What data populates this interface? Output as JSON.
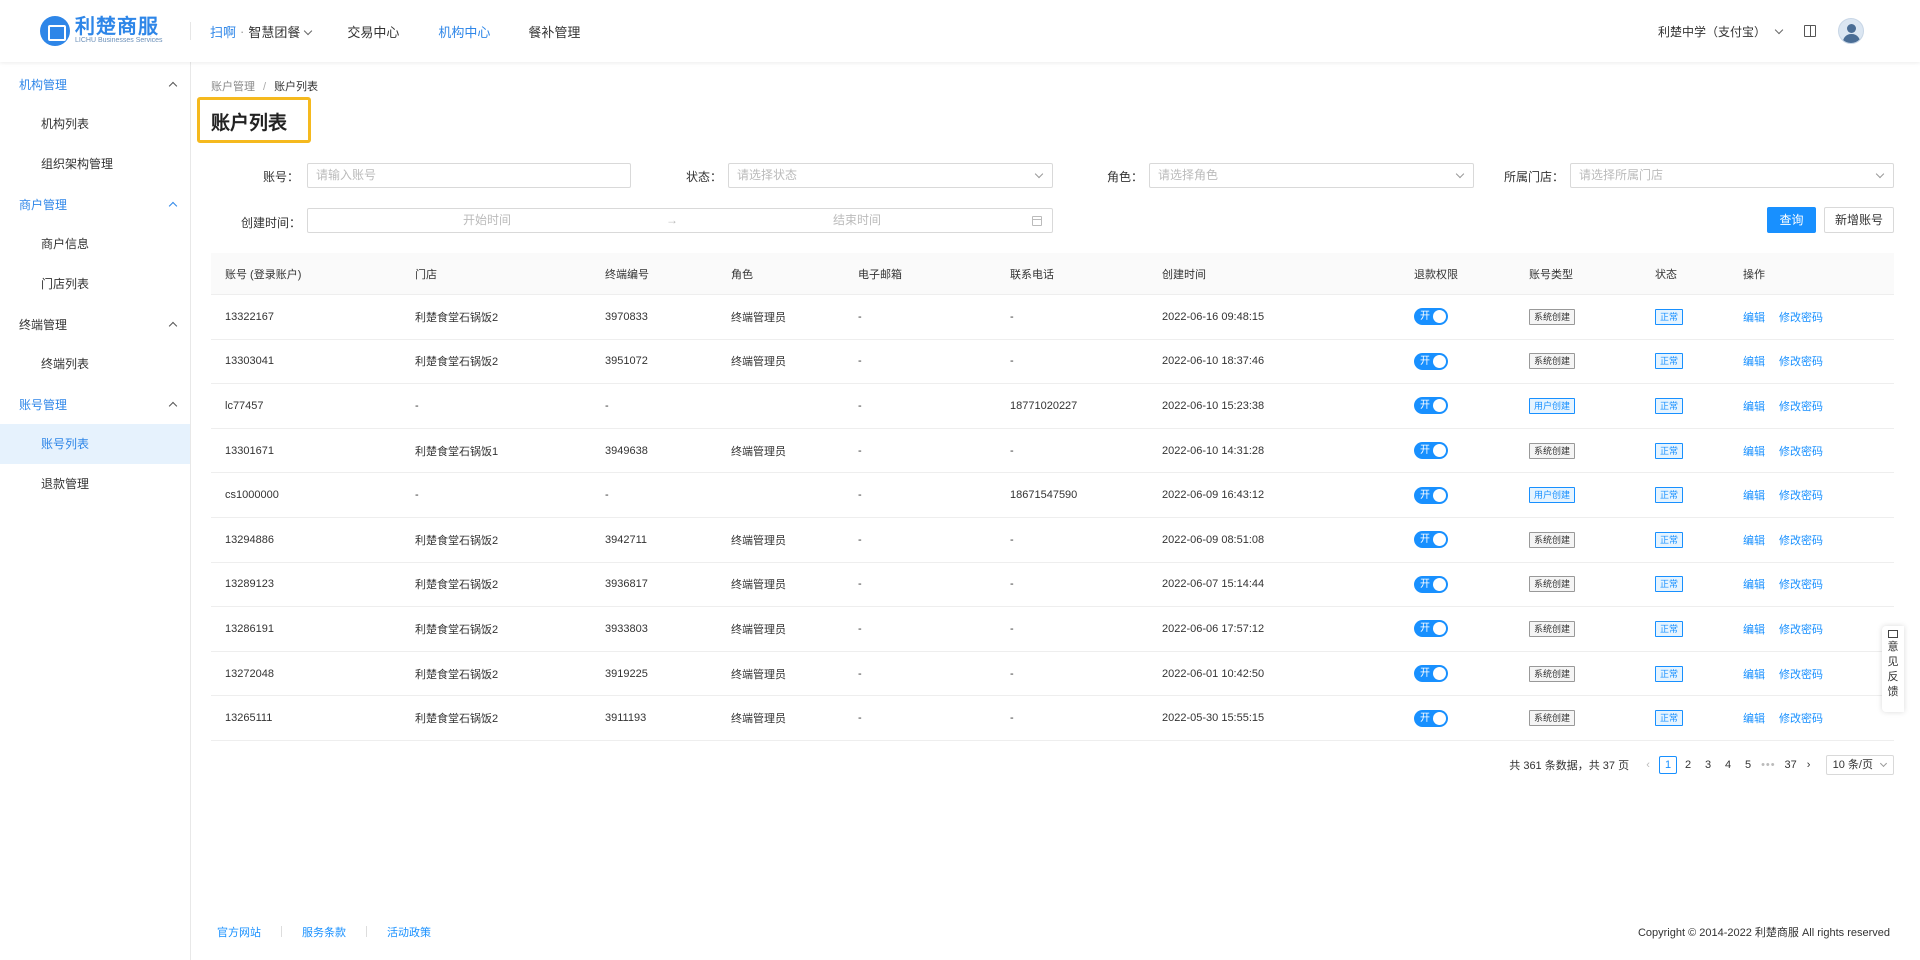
{
  "header": {
    "logo_cn": "利楚商服",
    "logo_en": "LICHU Businesses Services",
    "nav": {
      "scan": "扫啊",
      "dot": "·",
      "smart_meal": "智慧团餐",
      "trade_center": "交易中心",
      "org_center": "机构中心",
      "meal_subsidy": "餐补管理"
    },
    "account_name": "利楚中学（支付宝）"
  },
  "sidebar": {
    "groups": [
      {
        "label": "机构管理",
        "items": [
          "机构列表",
          "组织架构管理"
        ]
      },
      {
        "label": "商户管理",
        "items": [
          "商户信息",
          "门店列表"
        ]
      },
      {
        "label": "终端管理",
        "items": [
          "终端列表"
        ]
      },
      {
        "label": "账号管理",
        "items": [
          "账号列表",
          "退款管理"
        ]
      }
    ]
  },
  "breadcrumb": {
    "parent": "账户管理",
    "sep": "/",
    "current": "账户列表"
  },
  "page_title": "账户列表",
  "filters": {
    "account_label": "账号：",
    "account_placeholder": "请输入账号",
    "status_label": "状态：",
    "status_placeholder": "请选择状态",
    "role_label": "角色：",
    "role_placeholder": "请选择角色",
    "store_label": "所属门店：",
    "store_placeholder": "请选择所属门店",
    "created_label": "创建时间：",
    "start_placeholder": "开始时间",
    "date_sep": "→",
    "end_placeholder": "结束时间"
  },
  "buttons": {
    "query": "查询",
    "add_account": "新增账号"
  },
  "table": {
    "columns": [
      "账号 (登录账户)",
      "门店",
      "终端编号",
      "角色",
      "电子邮箱",
      "联系电话",
      "创建时间",
      "退款权限",
      "账号类型",
      "状态",
      "操作"
    ],
    "toggle_label": "开",
    "edit_label": "编辑",
    "change_pwd_label": "修改密码",
    "rows": [
      {
        "account": "13322167",
        "store": "利楚食堂石锅饭2",
        "terminal": "3970833",
        "role": "终端管理员",
        "email": "-",
        "phone": "-",
        "created": "2022-06-16 09:48:15",
        "type": "系统创建",
        "type_kind": "sys",
        "status": "正常"
      },
      {
        "account": "13303041",
        "store": "利楚食堂石锅饭2",
        "terminal": "3951072",
        "role": "终端管理员",
        "email": "-",
        "phone": "-",
        "created": "2022-06-10 18:37:46",
        "type": "系统创建",
        "type_kind": "sys",
        "status": "正常"
      },
      {
        "account": "lc77457",
        "store": "-",
        "terminal": "-",
        "role": "",
        "email": "-",
        "phone": "18771020227",
        "created": "2022-06-10 15:23:38",
        "type": "用户创建",
        "type_kind": "user",
        "status": "正常"
      },
      {
        "account": "13301671",
        "store": "利楚食堂石锅饭1",
        "terminal": "3949638",
        "role": "终端管理员",
        "email": "-",
        "phone": "-",
        "created": "2022-06-10 14:31:28",
        "type": "系统创建",
        "type_kind": "sys",
        "status": "正常"
      },
      {
        "account": "cs1000000",
        "store": "-",
        "terminal": "-",
        "role": "",
        "email": "-",
        "phone": "18671547590",
        "created": "2022-06-09 16:43:12",
        "type": "用户创建",
        "type_kind": "user",
        "status": "正常"
      },
      {
        "account": "13294886",
        "store": "利楚食堂石锅饭2",
        "terminal": "3942711",
        "role": "终端管理员",
        "email": "-",
        "phone": "-",
        "created": "2022-06-09 08:51:08",
        "type": "系统创建",
        "type_kind": "sys",
        "status": "正常"
      },
      {
        "account": "13289123",
        "store": "利楚食堂石锅饭2",
        "terminal": "3936817",
        "role": "终端管理员",
        "email": "-",
        "phone": "-",
        "created": "2022-06-07 15:14:44",
        "type": "系统创建",
        "type_kind": "sys",
        "status": "正常"
      },
      {
        "account": "13286191",
        "store": "利楚食堂石锅饭2",
        "terminal": "3933803",
        "role": "终端管理员",
        "email": "-",
        "phone": "-",
        "created": "2022-06-06 17:57:12",
        "type": "系统创建",
        "type_kind": "sys",
        "status": "正常"
      },
      {
        "account": "13272048",
        "store": "利楚食堂石锅饭2",
        "terminal": "3919225",
        "role": "终端管理员",
        "email": "-",
        "phone": "-",
        "created": "2022-06-01 10:42:50",
        "type": "系统创建",
        "type_kind": "sys",
        "status": "正常"
      },
      {
        "account": "13265111",
        "store": "利楚食堂石锅饭2",
        "terminal": "3911193",
        "role": "终端管理员",
        "email": "-",
        "phone": "-",
        "created": "2022-05-30 15:55:15",
        "type": "系统创建",
        "type_kind": "sys",
        "status": "正常"
      }
    ]
  },
  "pagination": {
    "summary": "共 361 条数据，共 37 页",
    "pages": [
      "1",
      "2",
      "3",
      "4",
      "5"
    ],
    "current_page": "1",
    "ellipsis": "•••",
    "last_page": "37",
    "page_size": "10 条/页"
  },
  "feedback": {
    "chars": [
      "意",
      "见",
      "反",
      "馈"
    ]
  },
  "footer": {
    "links": [
      "官方网站",
      "服务条款",
      "活动政策"
    ],
    "copyright": "Copyright © 2014-2022 利楚商服 All rights reserved"
  },
  "colors": {
    "primary": "#1890ff",
    "brand": "#2e86e8",
    "highlight_border": "#f5b91e",
    "active_menu_bg": "#e6f2fd"
  },
  "icons": [
    "logo-icon",
    "chevron-down-icon",
    "chevron-up-icon",
    "book-icon",
    "avatar-icon",
    "calendar-icon",
    "mail-icon",
    "chevron-left-icon",
    "chevron-right-icon"
  ]
}
